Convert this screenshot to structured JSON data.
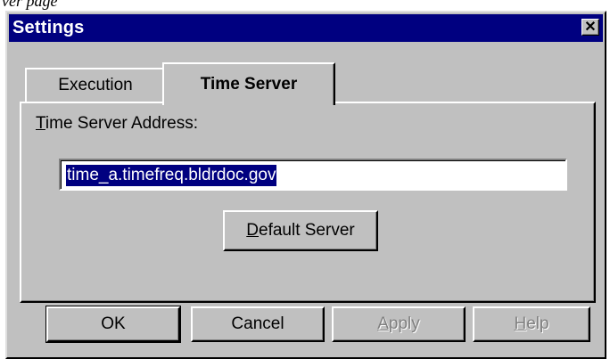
{
  "page_fragment": "ver page",
  "dialog": {
    "title": "Settings",
    "close_glyph": "✕"
  },
  "tabs": [
    {
      "label": "Execution",
      "active": false
    },
    {
      "label": "Time Server",
      "active": true
    }
  ],
  "time_server": {
    "label_mnemonic": "T",
    "label_rest": "ime Server Address:",
    "address_value": "time_a.timefreq.bldrdoc.gov",
    "default_server_mnemonic": "D",
    "default_server_rest": "efault Server"
  },
  "buttons": {
    "ok": "OK",
    "cancel": "Cancel",
    "apply_mnemonic": "A",
    "apply_rest": "pply",
    "help_mnemonic": "H",
    "help_rest": "elp"
  }
}
